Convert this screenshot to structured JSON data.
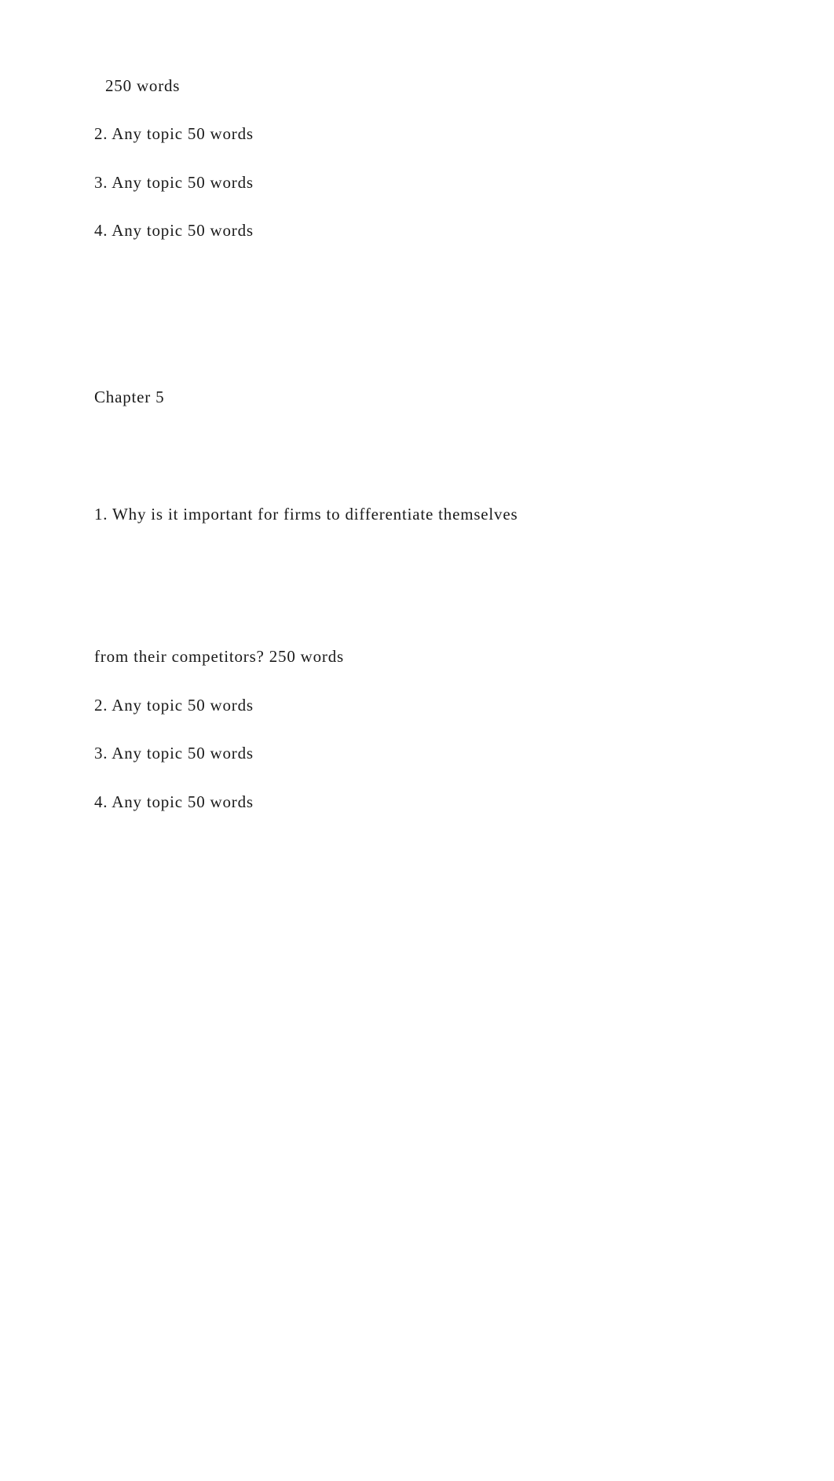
{
  "block1": {
    "prefix": "250 words",
    "items": [
      "2. Any topic 50 words",
      "3. Any topic 50 words",
      "4. Any topic 50 words"
    ]
  },
  "chapter": {
    "title": "Chapter 5",
    "question1_part1": "1. Why is it important for firms to differentiate themselves",
    "question1_part2": "from their competitors? 250 words",
    "items": [
      "2. Any topic 50 words",
      "3. Any topic 50 words",
      "4. Any topic 50 words"
    ]
  }
}
